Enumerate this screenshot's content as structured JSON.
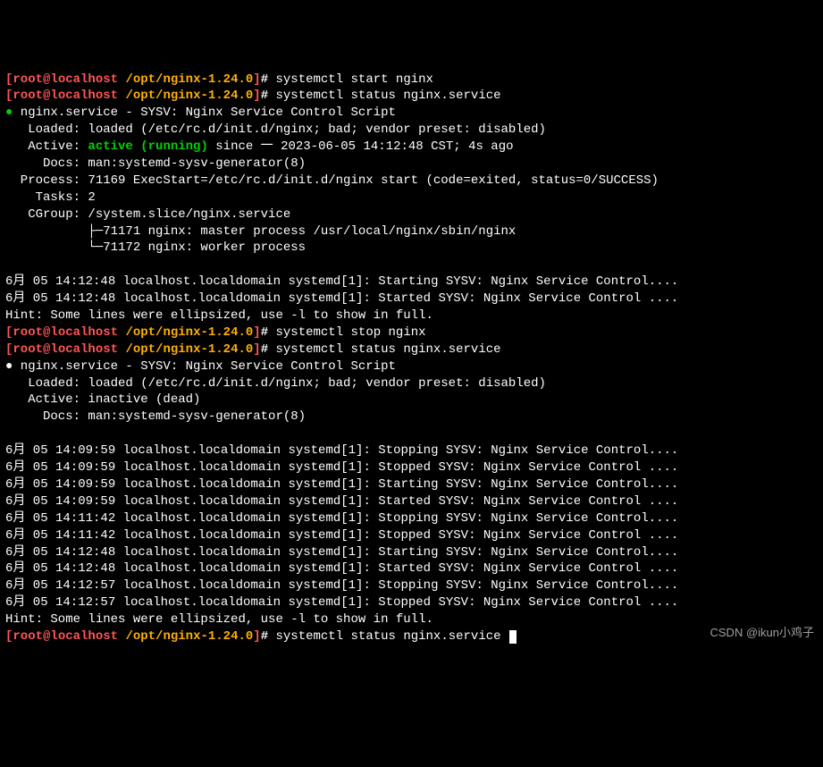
{
  "prompt": {
    "lb": "[",
    "user": "root",
    "at": "@",
    "host": "localhost",
    "sep": " ",
    "path": "/opt/nginx-1.24.0",
    "rb": "]",
    "hash": "#"
  },
  "cmds": {
    "c1": "systemctl start nginx",
    "c2": "systemctl status nginx.service",
    "c3": "systemctl stop nginx",
    "c4": "systemctl status nginx.service",
    "c5": "systemctl status nginx.service"
  },
  "status1": {
    "dot": "●",
    "title": " nginx.service - SYSV: Nginx Service Control Script",
    "loaded": "   Loaded: loaded (/etc/rc.d/init.d/nginx; bad; vendor preset: disabled)",
    "active_label": "   Active: ",
    "active_word": "active",
    "running_word": " (running)",
    "active_rest": " since 一 2023-06-05 14:12:48 CST; 4s ago",
    "docs": "     Docs: man:systemd-sysv-generator(8)",
    "process": "  Process: 71169 ExecStart=/etc/rc.d/init.d/nginx start (code=exited, status=0/SUCCESS)",
    "tasks": "    Tasks: 2",
    "cgroup": "   CGroup: /system.slice/nginx.service",
    "cg1": "           ├─71171 nginx: master process /usr/local/nginx/sbin/nginx",
    "cg2": "           └─71172 nginx: worker process"
  },
  "log1": {
    "l1": "6月 05 14:12:48 localhost.localdomain systemd[1]: Starting SYSV: Nginx Service Control....",
    "l2": "6月 05 14:12:48 localhost.localdomain systemd[1]: Started SYSV: Nginx Service Control ....",
    "hint": "Hint: Some lines were ellipsized, use -l to show in full."
  },
  "status2": {
    "dot": "●",
    "title": " nginx.service - SYSV: Nginx Service Control Script",
    "loaded": "   Loaded: loaded (/etc/rc.d/init.d/nginx; bad; vendor preset: disabled)",
    "active": "   Active: inactive (dead)",
    "docs": "     Docs: man:systemd-sysv-generator(8)"
  },
  "log2": {
    "l1": "6月 05 14:09:59 localhost.localdomain systemd[1]: Stopping SYSV: Nginx Service Control....",
    "l2": "6月 05 14:09:59 localhost.localdomain systemd[1]: Stopped SYSV: Nginx Service Control ....",
    "l3": "6月 05 14:09:59 localhost.localdomain systemd[1]: Starting SYSV: Nginx Service Control....",
    "l4": "6月 05 14:09:59 localhost.localdomain systemd[1]: Started SYSV: Nginx Service Control ....",
    "l5": "6月 05 14:11:42 localhost.localdomain systemd[1]: Stopping SYSV: Nginx Service Control....",
    "l6": "6月 05 14:11:42 localhost.localdomain systemd[1]: Stopped SYSV: Nginx Service Control ....",
    "l7": "6月 05 14:12:48 localhost.localdomain systemd[1]: Starting SYSV: Nginx Service Control....",
    "l8": "6月 05 14:12:48 localhost.localdomain systemd[1]: Started SYSV: Nginx Service Control ....",
    "l9": "6月 05 14:12:57 localhost.localdomain systemd[1]: Stopping SYSV: Nginx Service Control....",
    "l10": "6月 05 14:12:57 localhost.localdomain systemd[1]: Stopped SYSV: Nginx Service Control ....",
    "hint": "Hint: Some lines were ellipsized, use -l to show in full."
  },
  "watermark": "CSDN @ikun小鸡子"
}
